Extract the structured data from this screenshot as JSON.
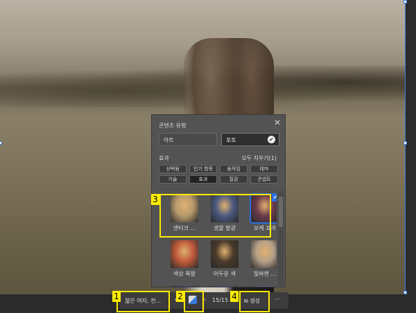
{
  "panel": {
    "title": "콘텐츠 유형",
    "close": "✕",
    "types": [
      {
        "label": "아트",
        "selected": false
      },
      {
        "label": "포토",
        "selected": true
      }
    ],
    "effects_label": "효과",
    "clear_all": "모두 지우기(1)",
    "chips": [
      {
        "label": "선택됨"
      },
      {
        "label": "인기 항목"
      },
      {
        "label": "움직임"
      },
      {
        "label": "테마"
      },
      {
        "label": "기술"
      },
      {
        "label": "효과",
        "active": true
      },
      {
        "label": "질감"
      },
      {
        "label": "콘셉트"
      }
    ],
    "thumbnails": [
      {
        "label": "앤티크 ...",
        "color": "#b79a6d"
      },
      {
        "label": "생물 발광",
        "color": "#4b5a80"
      },
      {
        "label": "보케 효과",
        "color": "#6a3a4a",
        "selected": true
      },
      {
        "label": "색상 폭발",
        "color": "#c05a3a"
      },
      {
        "label": "어두운 색",
        "color": "#4a3a2a"
      },
      {
        "label": "빛바랜 ...",
        "color": "#b5a088"
      },
      {
        "label": "",
        "color": "#3a4a80"
      },
      {
        "label": "",
        "color": "#4a5a90"
      },
      {
        "label": "",
        "color": "#5a6a90"
      }
    ]
  },
  "toolbar": {
    "prompt": "젊은 여자, 전...",
    "page": "15/15",
    "generate": "생성",
    "more": "···"
  },
  "annotations": [
    "1",
    "2",
    "3",
    "4"
  ]
}
